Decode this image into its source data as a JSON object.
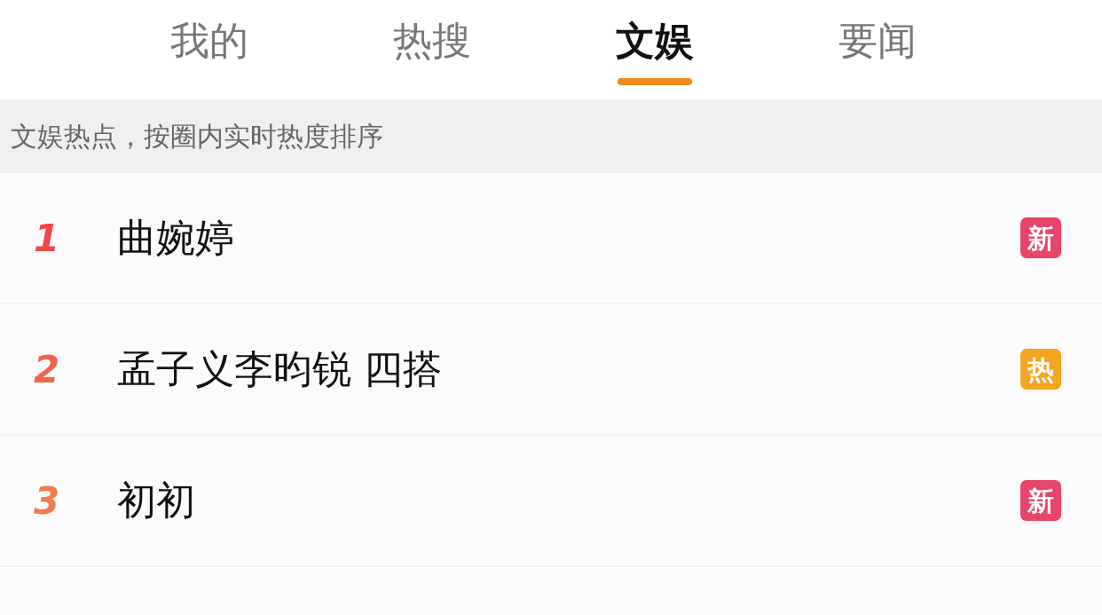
{
  "tabs": [
    {
      "label": "我的",
      "selected": false
    },
    {
      "label": "热搜",
      "selected": false
    },
    {
      "label": "文娱",
      "selected": true
    },
    {
      "label": "要闻",
      "selected": false
    }
  ],
  "notice": "文娱热点，按圈内实时热度排序",
  "items": [
    {
      "rank": "1",
      "title": "曲婉婷",
      "badge": {
        "kind": "new",
        "label": "新"
      }
    },
    {
      "rank": "2",
      "title": "孟子义李昀锐 四搭",
      "badge": {
        "kind": "hot",
        "label": "热"
      }
    },
    {
      "rank": "3",
      "title": "初初",
      "badge": {
        "kind": "new",
        "label": "新"
      }
    }
  ]
}
